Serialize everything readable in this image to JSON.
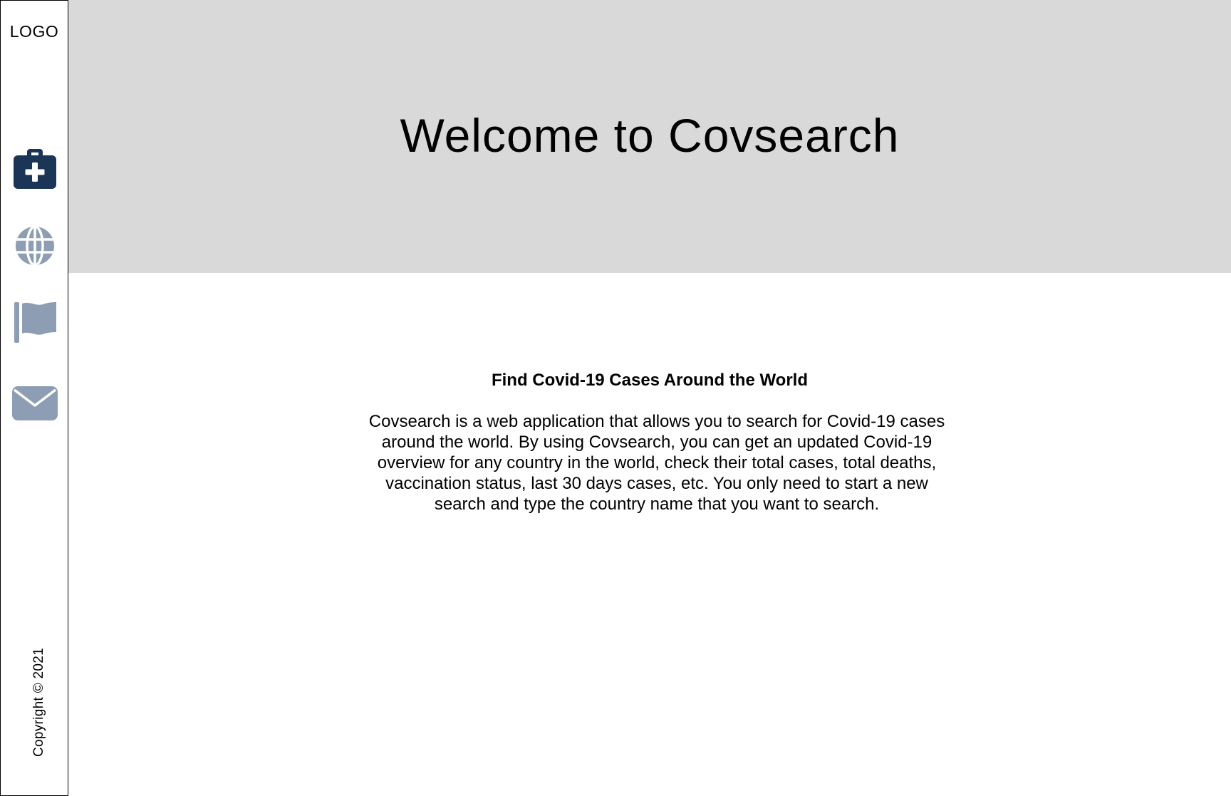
{
  "sidebar": {
    "logo": "LOGO",
    "nav": [
      {
        "icon": "medical-kit-icon",
        "color": "#1b3557"
      },
      {
        "icon": "globe-icon",
        "color": "#8d9db3"
      },
      {
        "icon": "flag-icon",
        "color": "#8d9db3"
      },
      {
        "icon": "envelope-icon",
        "color": "#8d9db3"
      }
    ],
    "copyright": "Copyright © 2021"
  },
  "hero": {
    "title": "Welcome to Covsearch",
    "background": "#d9d9d9"
  },
  "main": {
    "section_title": "Find Covid-19 Cases Around the World",
    "description": "Covsearch is a web application that allows you to search for Covid-19 cases around the world. By using Covsearch, you can get an updated Covid-19 overview for any country in the world, check their total cases, total deaths, vaccination status, last 30 days cases, etc. You only need to start a new search and type the country name that you want to search."
  }
}
